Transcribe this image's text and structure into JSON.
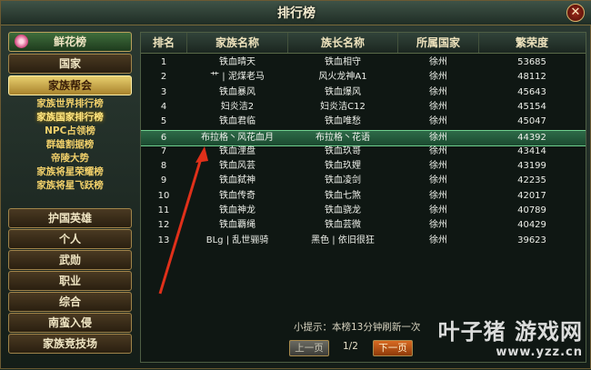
{
  "window": {
    "title": "排行榜"
  },
  "sidebar": {
    "flower_label": "鲜花榜",
    "items_top": [
      "国家",
      "家族帮会"
    ],
    "submenu": [
      "家族世界排行榜",
      "家族国家排行榜",
      "NPC占领榜",
      "群雄割据榜",
      "帝陵大势",
      "家族将星荣耀榜",
      "家族将星飞跃榜"
    ],
    "items_bottom": [
      "护国英雄",
      "个人",
      "武勋",
      "职业",
      "综合",
      "南蛮入侵",
      "家族竞技场"
    ]
  },
  "table": {
    "headers": [
      "排名",
      "家族名称",
      "族长名称",
      "所属国家",
      "繁荣度"
    ],
    "rows": [
      [
        "1",
        "铁血晴天",
        "铁血相守",
        "徐州",
        "53685"
      ],
      [
        "2",
        "艹 | 泥煤老马",
        "风火龙神A1",
        "徐州",
        "48112"
      ],
      [
        "3",
        "铁血暴风",
        "铁血爆风",
        "徐州",
        "45643"
      ],
      [
        "4",
        "妇炎洁2",
        "妇炎洁C12",
        "徐州",
        "45154"
      ],
      [
        "5",
        "铁血君临",
        "铁血唯愁",
        "徐州",
        "45047"
      ],
      [
        "6",
        "布拉格丶风花血月",
        "布拉格丶花语",
        "徐州",
        "44392"
      ],
      [
        "7",
        "铁血浬盘",
        "铁血玖哥",
        "徐州",
        "43414"
      ],
      [
        "8",
        "铁血风芸",
        "铁血玖娌",
        "徐州",
        "43199"
      ],
      [
        "9",
        "铁血弑神",
        "铁血凌剑",
        "徐州",
        "42235"
      ],
      [
        "10",
        "铁血传奇",
        "铁血七煞",
        "徐州",
        "42017"
      ],
      [
        "11",
        "铁血神龙",
        "铁血骁龙",
        "徐州",
        "40789"
      ],
      [
        "12",
        "铁血覇绳",
        "铁血芸微",
        "徐州",
        "40429"
      ],
      [
        "13",
        "BLg | 乱世骊骑",
        "黑色 | 依旧很狂",
        "徐州",
        "39623"
      ]
    ],
    "highlight_rank": "6"
  },
  "footer": {
    "tip": "小提示：本榜13分钟刷新一次",
    "prev_label": "上一页",
    "next_label": "下一页",
    "page": "1/2"
  },
  "watermark": {
    "name": "叶子猪 游戏网",
    "url": "www.yzz.cn"
  },
  "colors": {
    "highlight_row": "#2e6a48",
    "gold_active": "#e7cf6e",
    "arrow": "#e0301a"
  }
}
